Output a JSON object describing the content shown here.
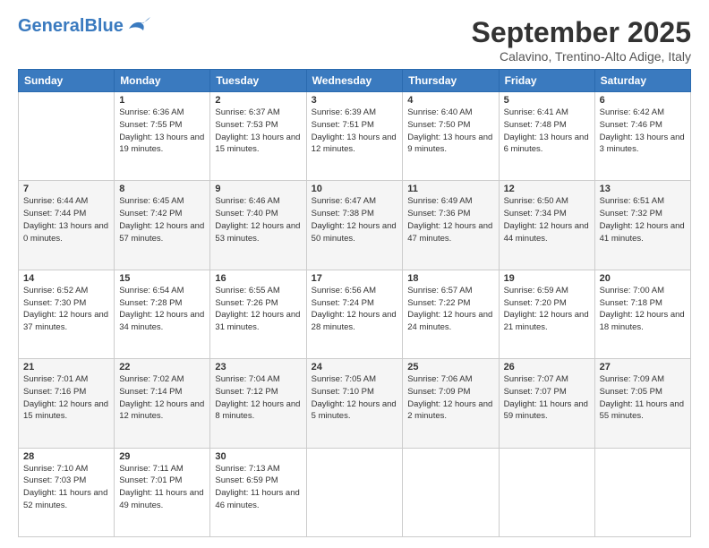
{
  "header": {
    "logo_general": "General",
    "logo_blue": "Blue",
    "month": "September 2025",
    "location": "Calavino, Trentino-Alto Adige, Italy"
  },
  "days_of_week": [
    "Sunday",
    "Monday",
    "Tuesday",
    "Wednesday",
    "Thursday",
    "Friday",
    "Saturday"
  ],
  "weeks": [
    [
      {
        "day": "",
        "sunrise": "",
        "sunset": "",
        "daylight": ""
      },
      {
        "day": "1",
        "sunrise": "Sunrise: 6:36 AM",
        "sunset": "Sunset: 7:55 PM",
        "daylight": "Daylight: 13 hours and 19 minutes."
      },
      {
        "day": "2",
        "sunrise": "Sunrise: 6:37 AM",
        "sunset": "Sunset: 7:53 PM",
        "daylight": "Daylight: 13 hours and 15 minutes."
      },
      {
        "day": "3",
        "sunrise": "Sunrise: 6:39 AM",
        "sunset": "Sunset: 7:51 PM",
        "daylight": "Daylight: 13 hours and 12 minutes."
      },
      {
        "day": "4",
        "sunrise": "Sunrise: 6:40 AM",
        "sunset": "Sunset: 7:50 PM",
        "daylight": "Daylight: 13 hours and 9 minutes."
      },
      {
        "day": "5",
        "sunrise": "Sunrise: 6:41 AM",
        "sunset": "Sunset: 7:48 PM",
        "daylight": "Daylight: 13 hours and 6 minutes."
      },
      {
        "day": "6",
        "sunrise": "Sunrise: 6:42 AM",
        "sunset": "Sunset: 7:46 PM",
        "daylight": "Daylight: 13 hours and 3 minutes."
      }
    ],
    [
      {
        "day": "7",
        "sunrise": "Sunrise: 6:44 AM",
        "sunset": "Sunset: 7:44 PM",
        "daylight": "Daylight: 13 hours and 0 minutes."
      },
      {
        "day": "8",
        "sunrise": "Sunrise: 6:45 AM",
        "sunset": "Sunset: 7:42 PM",
        "daylight": "Daylight: 12 hours and 57 minutes."
      },
      {
        "day": "9",
        "sunrise": "Sunrise: 6:46 AM",
        "sunset": "Sunset: 7:40 PM",
        "daylight": "Daylight: 12 hours and 53 minutes."
      },
      {
        "day": "10",
        "sunrise": "Sunrise: 6:47 AM",
        "sunset": "Sunset: 7:38 PM",
        "daylight": "Daylight: 12 hours and 50 minutes."
      },
      {
        "day": "11",
        "sunrise": "Sunrise: 6:49 AM",
        "sunset": "Sunset: 7:36 PM",
        "daylight": "Daylight: 12 hours and 47 minutes."
      },
      {
        "day": "12",
        "sunrise": "Sunrise: 6:50 AM",
        "sunset": "Sunset: 7:34 PM",
        "daylight": "Daylight: 12 hours and 44 minutes."
      },
      {
        "day": "13",
        "sunrise": "Sunrise: 6:51 AM",
        "sunset": "Sunset: 7:32 PM",
        "daylight": "Daylight: 12 hours and 41 minutes."
      }
    ],
    [
      {
        "day": "14",
        "sunrise": "Sunrise: 6:52 AM",
        "sunset": "Sunset: 7:30 PM",
        "daylight": "Daylight: 12 hours and 37 minutes."
      },
      {
        "day": "15",
        "sunrise": "Sunrise: 6:54 AM",
        "sunset": "Sunset: 7:28 PM",
        "daylight": "Daylight: 12 hours and 34 minutes."
      },
      {
        "day": "16",
        "sunrise": "Sunrise: 6:55 AM",
        "sunset": "Sunset: 7:26 PM",
        "daylight": "Daylight: 12 hours and 31 minutes."
      },
      {
        "day": "17",
        "sunrise": "Sunrise: 6:56 AM",
        "sunset": "Sunset: 7:24 PM",
        "daylight": "Daylight: 12 hours and 28 minutes."
      },
      {
        "day": "18",
        "sunrise": "Sunrise: 6:57 AM",
        "sunset": "Sunset: 7:22 PM",
        "daylight": "Daylight: 12 hours and 24 minutes."
      },
      {
        "day": "19",
        "sunrise": "Sunrise: 6:59 AM",
        "sunset": "Sunset: 7:20 PM",
        "daylight": "Daylight: 12 hours and 21 minutes."
      },
      {
        "day": "20",
        "sunrise": "Sunrise: 7:00 AM",
        "sunset": "Sunset: 7:18 PM",
        "daylight": "Daylight: 12 hours and 18 minutes."
      }
    ],
    [
      {
        "day": "21",
        "sunrise": "Sunrise: 7:01 AM",
        "sunset": "Sunset: 7:16 PM",
        "daylight": "Daylight: 12 hours and 15 minutes."
      },
      {
        "day": "22",
        "sunrise": "Sunrise: 7:02 AM",
        "sunset": "Sunset: 7:14 PM",
        "daylight": "Daylight: 12 hours and 12 minutes."
      },
      {
        "day": "23",
        "sunrise": "Sunrise: 7:04 AM",
        "sunset": "Sunset: 7:12 PM",
        "daylight": "Daylight: 12 hours and 8 minutes."
      },
      {
        "day": "24",
        "sunrise": "Sunrise: 7:05 AM",
        "sunset": "Sunset: 7:10 PM",
        "daylight": "Daylight: 12 hours and 5 minutes."
      },
      {
        "day": "25",
        "sunrise": "Sunrise: 7:06 AM",
        "sunset": "Sunset: 7:09 PM",
        "daylight": "Daylight: 12 hours and 2 minutes."
      },
      {
        "day": "26",
        "sunrise": "Sunrise: 7:07 AM",
        "sunset": "Sunset: 7:07 PM",
        "daylight": "Daylight: 11 hours and 59 minutes."
      },
      {
        "day": "27",
        "sunrise": "Sunrise: 7:09 AM",
        "sunset": "Sunset: 7:05 PM",
        "daylight": "Daylight: 11 hours and 55 minutes."
      }
    ],
    [
      {
        "day": "28",
        "sunrise": "Sunrise: 7:10 AM",
        "sunset": "Sunset: 7:03 PM",
        "daylight": "Daylight: 11 hours and 52 minutes."
      },
      {
        "day": "29",
        "sunrise": "Sunrise: 7:11 AM",
        "sunset": "Sunset: 7:01 PM",
        "daylight": "Daylight: 11 hours and 49 minutes."
      },
      {
        "day": "30",
        "sunrise": "Sunrise: 7:13 AM",
        "sunset": "Sunset: 6:59 PM",
        "daylight": "Daylight: 11 hours and 46 minutes."
      },
      {
        "day": "",
        "sunrise": "",
        "sunset": "",
        "daylight": ""
      },
      {
        "day": "",
        "sunrise": "",
        "sunset": "",
        "daylight": ""
      },
      {
        "day": "",
        "sunrise": "",
        "sunset": "",
        "daylight": ""
      },
      {
        "day": "",
        "sunrise": "",
        "sunset": "",
        "daylight": ""
      }
    ]
  ]
}
